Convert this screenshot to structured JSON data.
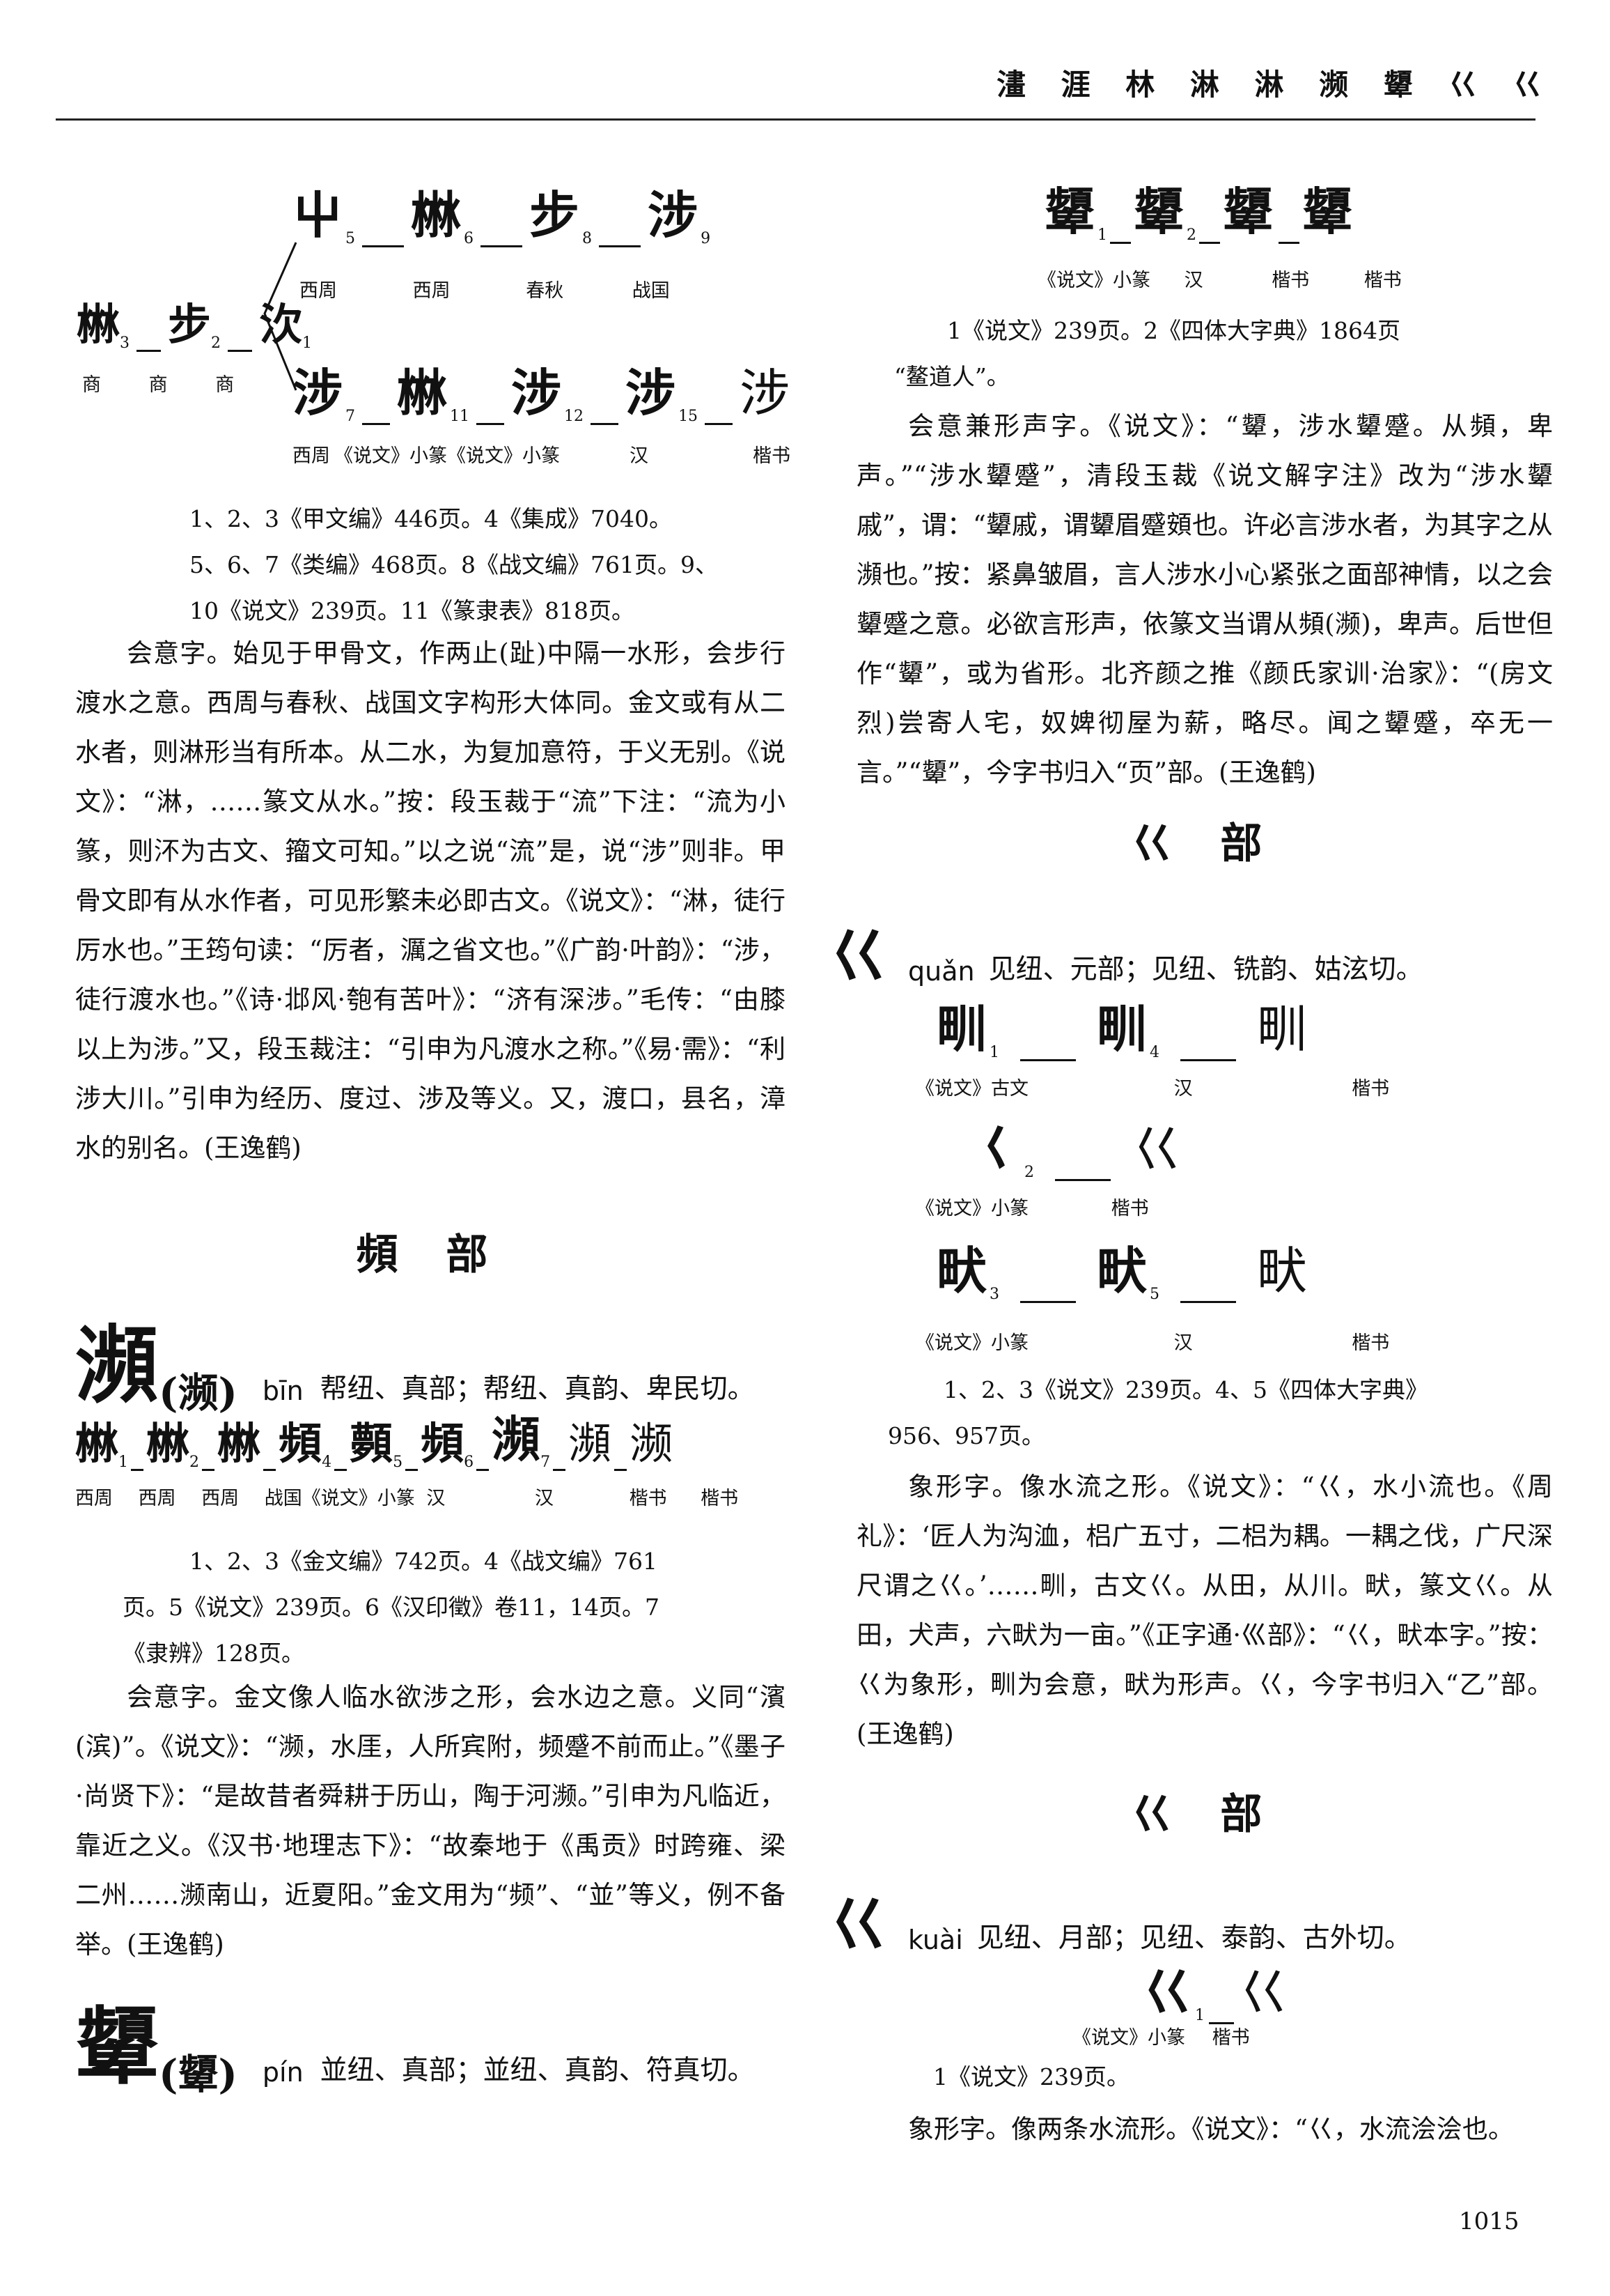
{
  "header": {
    "running_head": "澅 涯 林 淋 淋 濒 顰 巜 巜"
  },
  "left": {
    "she_evolution": {
      "top_glyphs": [
        "屮",
        "㴇",
        "步",
        "涉"
      ],
      "top_sups": [
        "5",
        "6",
        "8",
        "9"
      ],
      "top_caps": [
        "西周",
        "西周",
        "春秋",
        "战国"
      ],
      "left_glyphs": [
        "㴇",
        "步",
        "㳄"
      ],
      "left_sups": [
        "3",
        "2",
        "1"
      ],
      "left_caps": [
        "商",
        "商",
        "商"
      ],
      "bottom_glyphs": [
        "涉",
        "㴇",
        "涉",
        "涉",
        "涉"
      ],
      "bottom_sups": [
        "7",
        "11",
        "12",
        "15"
      ],
      "bottom_caps": [
        "西周",
        "《说文》小篆",
        "《说文》小篆",
        "汉",
        "楷书"
      ]
    },
    "she_notes": [
      "1、2、3《甲文编》446页。4《集成》7040。",
      "5、6、7《类编》468页。8《战文编》761页。9、",
      "10《说文》239页。11《篆隶表》818页。"
    ],
    "she_body": "会意字。始见于甲骨文，作两止(趾)中隔一水形，会步行渡水之意。西周与春秋、战国文字构形大体同。金文或有从二水者，则淋形当有所本。从二水，为复加意符，于义无别。《说文》：“淋，……篆文从水。”按：段玉裁于“流”下注：“流为小篆，则㳅为古文、籀文可知。”以之说“流”是，说“涉”则非。甲骨文即有从水作者，可见形繁未必即古文。《说文》：“淋，徒行厉水也。”王筠句读：“厉者，濿之省文也。”《广韵·叶韵》：“涉，徒行渡水也。”《诗·邶风·匏有苦叶》：“济有深涉。”毛传：“由膝以上为涉。”又，段玉裁注：“引申为凡渡水之称。”《易·需》：“利涉大川。”引申为经历、度过、涉及等义。又，渡口，县名，漳水的别名。(王逸鹤)",
    "pin_section_title": "頻 部",
    "bin": {
      "char": "瀕",
      "variant": "(濒)",
      "pinyin": "bīn",
      "pron": "帮纽、真部；帮纽、真韵、卑民切。",
      "glyphs": [
        "㴇",
        "㴇",
        "㴇",
        "頻",
        "顭",
        "頻",
        "瀕",
        "瀕",
        "濒"
      ],
      "sups": [
        "1",
        "2",
        "",
        "4",
        "5",
        "6",
        "7",
        "",
        ""
      ],
      "caps": [
        "西周",
        "西周",
        "西周",
        "战国《说文》小篆",
        "汉",
        "汉",
        "楷书",
        "楷书"
      ],
      "notes": [
        "1、2、3《金文编》742页。4《战文编》761",
        "页。5《说文》239页。6《汉印徵》卷11，14页。7",
        "《隶辨》128页。"
      ],
      "body": "会意字。金文像人临水欲涉之形，会水边之意。义同“濱(滨)”。《说文》：“濒，水厓，人所宾附，频蹙不前而止。”《墨子·尚贤下》：“是故昔者舜耕于历山，陶于河濒。”引申为凡临近，靠近之义。《汉书·地理志下》：“故秦地于《禹贡》时跨雍、梁二州……濒南山，近夏阳。”金文用为“频”、“並”等义，例不备举。(王逸鹤)"
    },
    "pin": {
      "char": "顰",
      "variant": "(顰)",
      "pinyin": "pín",
      "pron": "並纽、真部；並纽、真韵、符真切。"
    }
  },
  "right": {
    "pin_evolution": {
      "glyphs": [
        "顰",
        "顰",
        "顰",
        "顰"
      ],
      "sups": [
        "1",
        "2",
        "",
        ""
      ],
      "caps": [
        "《说文》小篆",
        "汉",
        "楷书",
        "楷书"
      ]
    },
    "pin_notes": [
      "1《说文》239页。2《四体大字典》1864页",
      "“鳌道人”。"
    ],
    "pin_body": "会意兼形声字。《说文》：“顰，涉水顰蹙。从頻，卑声。”“涉水顰蹙”，清段玉裁《说文解字注》改为“涉水顰戚”，谓：“顰戚，谓顰眉蹙頞也。许必言涉水者，为其字之从瀕也。”按：紧鼻皱眉，言人涉水小心紧张之面部神情，以之会顰蹙之意。必欲言形声，依篆文当谓从頻(濒)，卑声。后世但作“顰”，或为省形。北齐颜之推《颜氏家训·治家》：“(房文烈)尝寄人宅，奴婢彻屋为薪，略尽。闻之顰蹙，卒无一言。”“顰”，今字书归入“页”部。(王逸鹤)",
    "quan_section_title": "巜 部",
    "quan": {
      "char": "巜",
      "pinyin": "quǎn",
      "pron": "见纽、元部；见纽、铣韵、姑泫切。",
      "row1": {
        "glyphs": [
          "甽",
          "甽",
          "甽"
        ],
        "sups": [
          "1",
          "4",
          ""
        ],
        "caps": [
          "《说文》古文",
          "汉",
          "楷书"
        ]
      },
      "row2": {
        "glyphs": [
          "𡿨",
          "巜"
        ],
        "sups": [
          "2",
          ""
        ],
        "caps": [
          "《说文》小篆",
          "楷书"
        ]
      },
      "row3": {
        "glyphs": [
          "畎",
          "畎",
          "畎"
        ],
        "sups": [
          "3",
          "5",
          ""
        ],
        "caps": [
          "《说文》小篆",
          "汉",
          "楷书"
        ]
      },
      "notes": [
        "1、2、3《说文》239页。4、5《四体大字典》",
        "956、957页。"
      ],
      "body": "象形字。像水流之形。《说文》：“巜，水小流也。《周礼》：‘匠人为沟洫，梠广五寸，二梠为耦。一耦之伐，广尺深尺谓之巜。’……甽，古文巜。从田，从川。畎，篆文巜。从田，犬声，六畎为一亩。”《正字通·巛部》：“巜，畎本字。”按：巜为象形，甽为会意，畎为形声。巜，今字书归入“乙”部。(王逸鹤)"
    },
    "kuai_section_title": "巜 部",
    "kuai": {
      "char": "巜",
      "pinyin": "kuài",
      "pron": "见纽、月部；见纽、泰韵、古外切。",
      "glyphs": [
        "巜",
        "巜"
      ],
      "sups": [
        "1",
        ""
      ],
      "caps": [
        "《说文》小篆",
        "楷书"
      ],
      "notes": [
        "1《说文》239页。"
      ],
      "body": "象形字。像两条水流形。《说文》：“巜，水流浍浍也。"
    },
    "page_number": "1015"
  }
}
